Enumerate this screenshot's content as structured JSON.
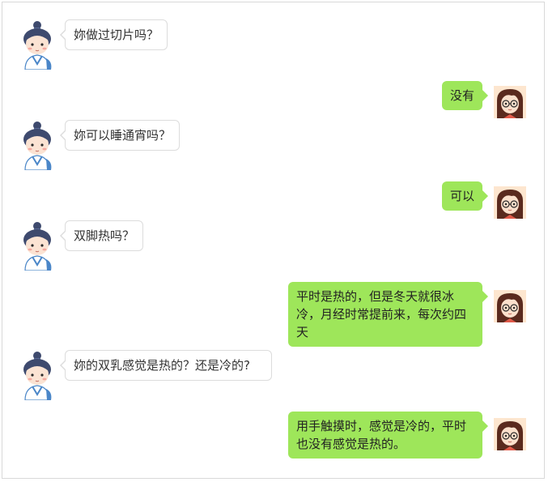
{
  "colors": {
    "outgoing_bubble": "#9ee65a",
    "incoming_bubble": "#ffffff",
    "incoming_border": "#dcdcdc",
    "text": "#333333"
  },
  "icons": {
    "doctor_avatar": "doctor-avatar-icon",
    "patient_avatar": "patient-avatar-icon"
  },
  "messages": [
    {
      "sender": "doctor",
      "text": "妳做过切片吗？"
    },
    {
      "sender": "patient",
      "text": "没有"
    },
    {
      "sender": "doctor",
      "text": "妳可以睡通宵吗？"
    },
    {
      "sender": "patient",
      "text": "可以"
    },
    {
      "sender": "doctor",
      "text": "双脚热吗？"
    },
    {
      "sender": "patient",
      "text": "平时是热的，但是冬天就很冰冷，月经时常提前来，每次约四天"
    },
    {
      "sender": "doctor",
      "text": "妳的双乳感觉是热的？还是冷的?"
    },
    {
      "sender": "patient",
      "text": "用手触摸时，感觉是冷的，平时也没有感觉是热的。"
    }
  ]
}
